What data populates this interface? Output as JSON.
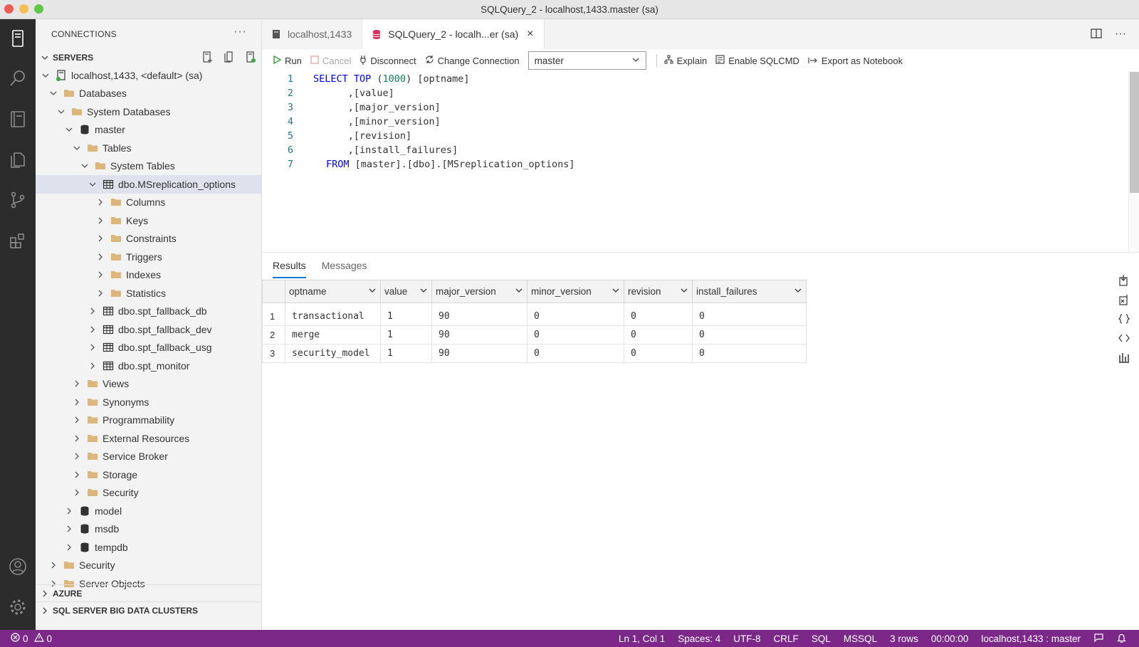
{
  "window": {
    "title": "SQLQuery_2 - localhost,1433.master (sa)"
  },
  "sidebar": {
    "header": "CONNECTIONS",
    "more_label": "···",
    "servers_section": "SERVERS",
    "tree": [
      {
        "label": "localhost,1433, <default> (sa)",
        "icon": "server-icon",
        "expanded": true
      },
      {
        "label": "Databases",
        "icon": "folder-icon",
        "expanded": true
      },
      {
        "label": "System Databases",
        "icon": "folder-icon",
        "expanded": true
      },
      {
        "label": "master",
        "icon": "database-icon",
        "expanded": true
      },
      {
        "label": "Tables",
        "icon": "folder-icon",
        "expanded": true
      },
      {
        "label": "System Tables",
        "icon": "folder-icon",
        "expanded": true
      },
      {
        "label": "dbo.MSreplication_options",
        "icon": "table-icon",
        "expanded": true
      },
      {
        "label": "Columns",
        "icon": "folder-icon",
        "expanded": false
      },
      {
        "label": "Keys",
        "icon": "folder-icon",
        "expanded": false
      },
      {
        "label": "Constraints",
        "icon": "folder-icon",
        "expanded": false
      },
      {
        "label": "Triggers",
        "icon": "folder-icon",
        "expanded": false
      },
      {
        "label": "Indexes",
        "icon": "folder-icon",
        "expanded": false
      },
      {
        "label": "Statistics",
        "icon": "folder-icon",
        "expanded": false
      },
      {
        "label": "dbo.spt_fallback_db",
        "icon": "table-icon",
        "expanded": false
      },
      {
        "label": "dbo.spt_fallback_dev",
        "icon": "table-icon",
        "expanded": false
      },
      {
        "label": "dbo.spt_fallback_usg",
        "icon": "table-icon",
        "expanded": false
      },
      {
        "label": "dbo.spt_monitor",
        "icon": "table-icon",
        "expanded": false
      },
      {
        "label": "Views",
        "icon": "folder-icon",
        "expanded": false
      },
      {
        "label": "Synonyms",
        "icon": "folder-icon",
        "expanded": false
      },
      {
        "label": "Programmability",
        "icon": "folder-icon",
        "expanded": false
      },
      {
        "label": "External Resources",
        "icon": "folder-icon",
        "expanded": false
      },
      {
        "label": "Service Broker",
        "icon": "folder-icon",
        "expanded": false
      },
      {
        "label": "Storage",
        "icon": "folder-icon",
        "expanded": false
      },
      {
        "label": "Security",
        "icon": "folder-icon",
        "expanded": false
      },
      {
        "label": "model",
        "icon": "database-icon",
        "expanded": false
      },
      {
        "label": "msdb",
        "icon": "database-icon",
        "expanded": false
      },
      {
        "label": "tempdb",
        "icon": "database-icon",
        "expanded": false
      },
      {
        "label": "Security",
        "icon": "folder-icon",
        "expanded": false
      },
      {
        "label": "Server Objects",
        "icon": "folder-icon",
        "expanded": false
      }
    ],
    "azure_section": "AZURE",
    "bdc_section": "SQL SERVER BIG DATA CLUSTERS"
  },
  "tabs": [
    {
      "label": "localhost,1433",
      "icon": "file-icon",
      "active": false
    },
    {
      "label": "SQLQuery_2 - localh...er (sa)",
      "icon": "query-icon",
      "active": true
    }
  ],
  "toolbar": {
    "run": "Run",
    "cancel": "Cancel",
    "disconnect": "Disconnect",
    "change_connection": "Change Connection",
    "database": "master",
    "explain": "Explain",
    "enable_sqlcmd": "Enable SQLCMD",
    "export_notebook": "Export as Notebook"
  },
  "editor": {
    "lines": [
      {
        "n": "1",
        "kw": "SELECT TOP",
        "num": "1000",
        "rest": "[optname]"
      },
      {
        "n": "2",
        "text": "      ,[value]"
      },
      {
        "n": "3",
        "text": "      ,[major_version]"
      },
      {
        "n": "4",
        "text": "      ,[minor_version]"
      },
      {
        "n": "5",
        "text": "      ,[revision]"
      },
      {
        "n": "6",
        "text": "      ,[install_failures]"
      },
      {
        "n": "7",
        "kw": "FROM",
        "text": " [master].[dbo].[MSreplication_options]"
      }
    ]
  },
  "results": {
    "tabs": [
      "Results",
      "Messages"
    ],
    "columns": [
      "optname",
      "value",
      "major_version",
      "minor_version",
      "revision",
      "install_failures"
    ],
    "rows": [
      [
        "1",
        "transactional",
        "1",
        "90",
        "0",
        "0",
        "0"
      ],
      [
        "2",
        "merge",
        "1",
        "90",
        "0",
        "0",
        "0"
      ],
      [
        "3",
        "security_model",
        "1",
        "90",
        "0",
        "0",
        "0"
      ]
    ]
  },
  "statusbar": {
    "errors": "0",
    "warnings": "0",
    "position": "Ln 1, Col 1",
    "spaces": "Spaces: 4",
    "encoding": "UTF-8",
    "eol": "CRLF",
    "language": "SQL",
    "provider": "MSSQL",
    "rows": "3 rows",
    "time": "00:00:00",
    "connection": "localhost,1433 : master"
  },
  "colors": {
    "activity_bar": "#2c2c2c",
    "status_bar": "#7b2888",
    "accent": "#0078d4",
    "folder": "#dcb67a",
    "keyword": "#0000ff",
    "number": "#098658"
  }
}
